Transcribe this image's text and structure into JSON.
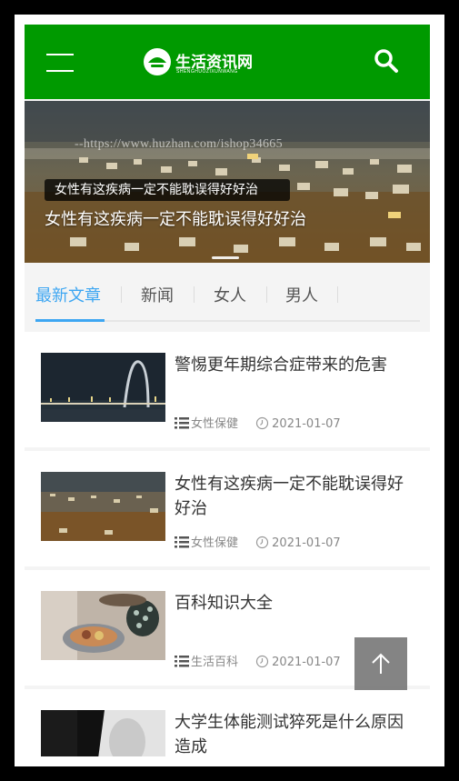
{
  "header": {
    "logo_title": "生活资讯网",
    "logo_subtitle": "SHENGHUOZIXUNWANG",
    "menu_icon": "hamburger-menu-icon",
    "search_icon": "search-icon",
    "background_color": "#009a00"
  },
  "banner": {
    "watermark": "--https://www.huzhan.com/ishop34665",
    "tag": "女性有这疾病一定不能耽误得好好治",
    "caption": "女性有这疾病一定不能耽误得好好治"
  },
  "tabs": [
    {
      "label": "最新文章",
      "active": true
    },
    {
      "label": "新闻",
      "active": false
    },
    {
      "label": "女人",
      "active": false
    },
    {
      "label": "男人",
      "active": false
    }
  ],
  "accent_color": "#3da6f2",
  "articles": [
    {
      "title": "警惕更年期综合症带来的危害",
      "category": "女性保健",
      "date": "2021-01-07"
    },
    {
      "title": "女性有这疾病一定不能耽误得好好治",
      "category": "女性保健",
      "date": "2021-01-07"
    },
    {
      "title": "百科知识大全",
      "category": "生活百科",
      "date": "2021-01-07"
    },
    {
      "title": "大学生体能测试猝死是什么原因造成",
      "category": "",
      "date": ""
    }
  ],
  "back_to_top_icon": "arrow-up-icon"
}
